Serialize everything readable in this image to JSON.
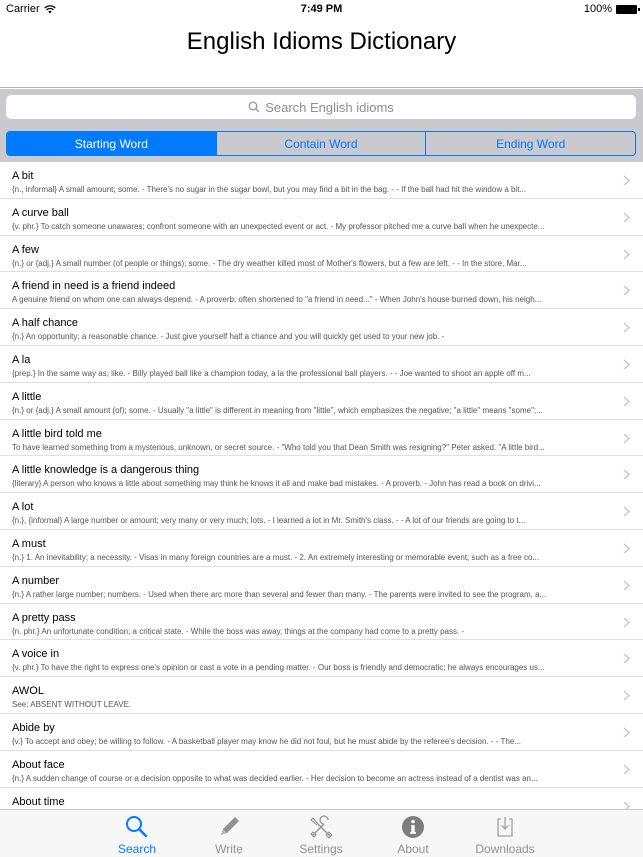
{
  "status_bar": {
    "carrier": "Carrier",
    "time": "7:49 PM",
    "battery": "100%"
  },
  "nav": {
    "title": "English Idioms Dictionary"
  },
  "search": {
    "placeholder": "Search English idioms"
  },
  "segments": [
    {
      "label": "Starting Word",
      "active": true
    },
    {
      "label": "Contain Word",
      "active": false
    },
    {
      "label": "Ending Word",
      "active": false
    }
  ],
  "colors": {
    "accent": "#007aff",
    "search_bg": "#c9c9ce",
    "tab_inactive": "#929292"
  },
  "idioms": [
    {
      "title": "A bit",
      "detail": "{n., informal} A small amount; some.   -  There's no sugar in the sugar bowl, but you may find a bit in the bag.   -   -  If the ball had hit the window a bit..."
    },
    {
      "title": "A curve ball",
      "detail": "{v. phr.} To catch someone unawares; confront someone with an unexpected event or act.   -  My professor pitched me a curve ball when he unexpecte..."
    },
    {
      "title": "A few",
      "detail": "{n.} or {adj.} A small number (of people or things); some.   -  The dry weather killed most of Mother's flowers, but a few are left.   -   -  In the store, Mar..."
    },
    {
      "title": "A friend in need is a friend indeed",
      "detail": "A genuine friend on whom one can always depend. - A proverb; often shortened to \"a friend in need...\"   -  When John's house burned down, his neigh..."
    },
    {
      "title": "A half chance",
      "detail": "{n.} An opportunity; a reasonable chance.   -  Just give yourself half a chance and you will quickly get used to your new job.   -"
    },
    {
      "title": "A la",
      "detail": "{prep.} In the same way as; like.   -  Billy played ball like a champion today, a la the professional ball players.   -   -  Joe wanted to shoot an apple off m..."
    },
    {
      "title": "A little",
      "detail": "{n.} or {adj.} A small amount (of); some. - Usually \"a little\" is different in meaning from \"little\", which emphasizes the negative; \"a little\" means \"some\";..."
    },
    {
      "title": "A little bird told me",
      "detail": "To have learned something from a mysterious, unknown, or secret source.   -  \"Who told you that Dean Smith was resigning?\" Peter asked. \"A little bird..."
    },
    {
      "title": "A little knowledge is a dangerous thing",
      "detail": "{literary} A person who knows a little about something may think he knows it all and make bad mistakes. - A proverb.   -  John has read a book on drivi..."
    },
    {
      "title": "A lot",
      "detail": "{n.}, {informal} A large number or amount; very many or very much; lots.   -  I learned a lot in Mr. Smith's class.   -   -  A lot of our friends are going to t..."
    },
    {
      "title": "A must",
      "detail": "{n.} 1. An inevitability; a necessity.   -  Visas in many foreign countries are a must.   -  2. An extremely interesting or memorable event, such as a free co..."
    },
    {
      "title": "A number",
      "detail": "{n.} A rather large number; numbers. - Used when there arc more than several and fewer than many.   -  The parents were invited to see the program, a..."
    },
    {
      "title": "A pretty pass",
      "detail": "{n. phr.} An unfortunate condition; a critical state.   -  While the boss was away, things at the company had come to a pretty pass.   -"
    },
    {
      "title": "A voice in",
      "detail": "{v. phr.} To have the right to express one's opinion or cast a vote in a pending matter.   -  Our boss is friendly and democratic; he always encourages us..."
    },
    {
      "title": "AWOL",
      "detail": "See: ABSENT WITHOUT LEAVE."
    },
    {
      "title": "Abide by",
      "detail": "{v.} To accept and obey; be willing to follow.   -  A basketball player may know he did not foul, but he must abide by the referee's decision.   -   -  The..."
    },
    {
      "title": "About face",
      "detail": "{n.} A sudden change of course or a decision opposite to what was decided earlier.   -  Her decision to become an actress instead of a dentist was an..."
    },
    {
      "title": "About time",
      "detail": ""
    }
  ],
  "tabs": [
    {
      "label": "Search",
      "icon": "search-icon",
      "active": true
    },
    {
      "label": "Write",
      "icon": "pencil-icon",
      "active": false
    },
    {
      "label": "Settings",
      "icon": "wrench-screwdriver-icon",
      "active": false
    },
    {
      "label": "About",
      "icon": "info-icon",
      "active": false
    },
    {
      "label": "Downloads",
      "icon": "download-icon",
      "active": false
    }
  ]
}
